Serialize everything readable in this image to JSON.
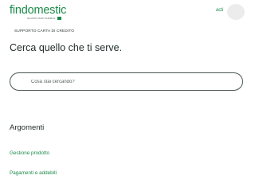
{
  "header": {
    "logo_text": "findomestic",
    "logo_subtext": "GRUPPO BNP PARIBAS",
    "user_link": "acti"
  },
  "breadcrumb": "SUPPORTO CARTA DI CREDITO",
  "page_title": "Cerca quello che ti serve.",
  "search": {
    "placeholder": "Cosa stai cercando?"
  },
  "topics": {
    "title": "Argomenti",
    "items": [
      {
        "label": "Gestione prodotto"
      },
      {
        "label": "Pagamenti e addebiti"
      }
    ]
  },
  "colors": {
    "brand_green": "#1b8a4a"
  }
}
